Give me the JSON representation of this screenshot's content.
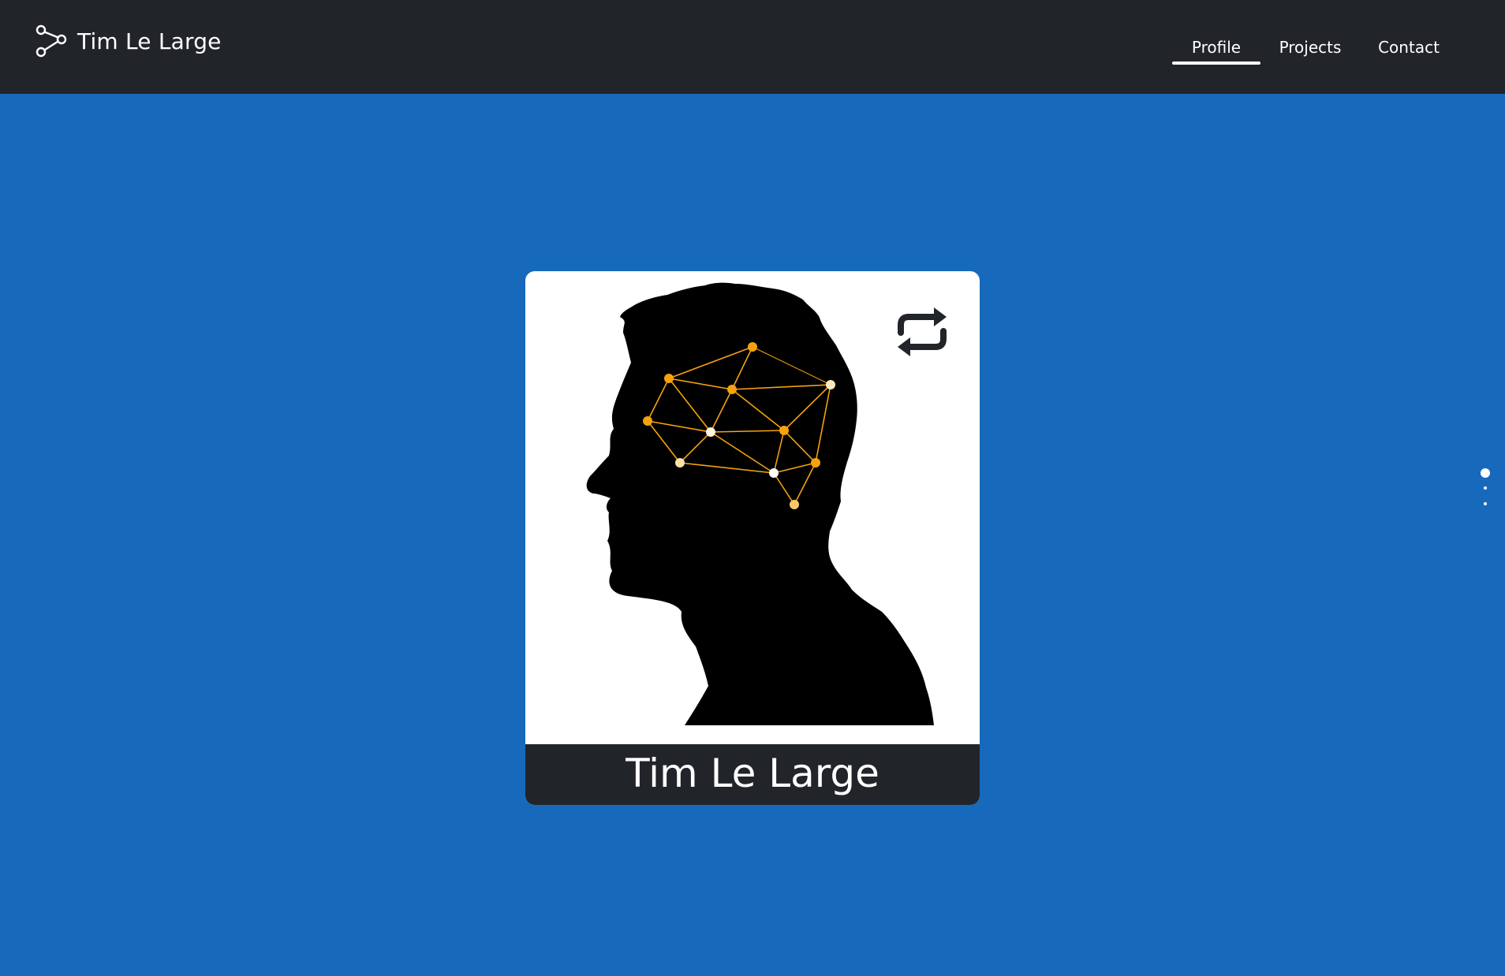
{
  "brand": {
    "name": "Tim Le Large",
    "icon": "share-nodes-icon"
  },
  "nav": {
    "items": [
      {
        "label": "Profile",
        "active": true
      },
      {
        "label": "Projects",
        "active": false
      },
      {
        "label": "Contact",
        "active": false
      }
    ]
  },
  "profile_card": {
    "name": "Tim Le Large",
    "image": "head-silhouette-with-network-graphic",
    "flip_icon": "repeat-arrows-icon"
  },
  "pagination": {
    "count": 3,
    "current": 1
  },
  "colors": {
    "page_background": "#1769bc",
    "navbar_background": "#212429",
    "card_background": "#ffffff",
    "card_footer": "#212429",
    "network_accent": "#f5a20e"
  }
}
